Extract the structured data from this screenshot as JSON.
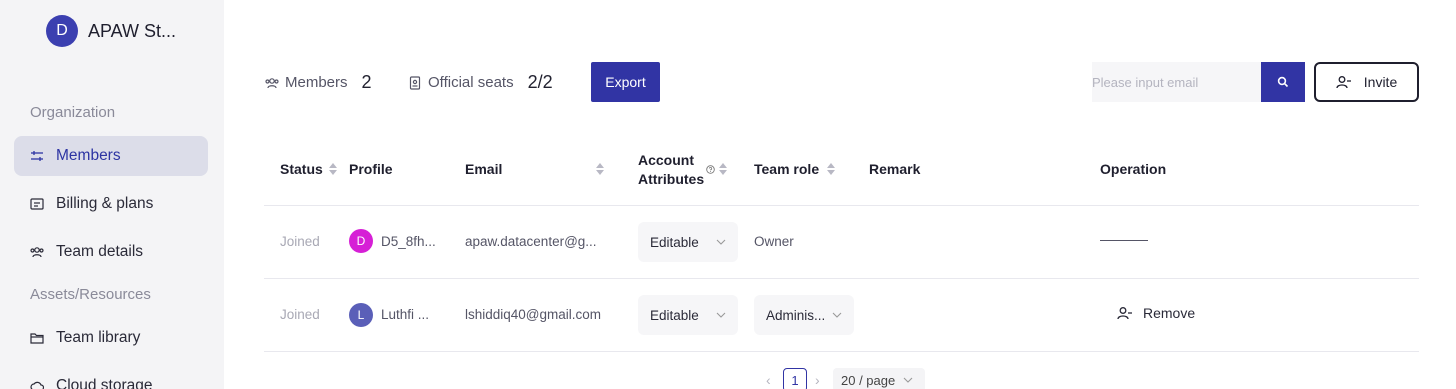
{
  "organization": {
    "initial": "D",
    "name": "APAW St..."
  },
  "sidebar": {
    "section_organization": "Organization",
    "section_assets": "Assets/Resources",
    "items": [
      {
        "label": "Members",
        "icon": "sliders-icon",
        "active": true
      },
      {
        "label": "Billing & plans",
        "icon": "receipt-icon",
        "active": false
      },
      {
        "label": "Team details",
        "icon": "team-icon",
        "active": false
      },
      {
        "label": "Team library",
        "icon": "folder-icon",
        "active": false
      },
      {
        "label": "Cloud storage",
        "icon": "cloud-icon",
        "active": false
      }
    ]
  },
  "toolbar": {
    "members_label": "Members",
    "members_count": "2",
    "seats_label": "Official seats",
    "seats_value": "2/2",
    "export_label": "Export",
    "search_placeholder": "Please input email",
    "invite_label": "Invite"
  },
  "table": {
    "headers": {
      "status": "Status",
      "profile": "Profile",
      "email": "Email",
      "account_attributes_line1": "Account",
      "account_attributes_line2": "Attributes",
      "team_role": "Team role",
      "remark": "Remark",
      "operation": "Operation"
    },
    "rows": [
      {
        "status": "Joined",
        "avatar_initial": "D",
        "avatar_color": "#d61fd6",
        "profile": "D5_8fh...",
        "email": "apaw.datacenter@g...",
        "account_attribute": "Editable",
        "team_role": "Owner",
        "remark": "",
        "operation": ""
      },
      {
        "status": "Joined",
        "avatar_initial": "L",
        "avatar_color": "#5a5fb8",
        "profile": "Luthfi ...",
        "email": "lshiddiq40@gmail.com",
        "account_attribute": "Editable",
        "team_role": "Adminis...",
        "remark": "",
        "operation": "Remove"
      }
    ]
  },
  "pagination": {
    "current_page": "1",
    "page_size": "20 / page"
  },
  "colors": {
    "accent": "#3134a4",
    "sidebar_bg": "#f4f4f6",
    "active_item_bg": "#dcdde9"
  }
}
